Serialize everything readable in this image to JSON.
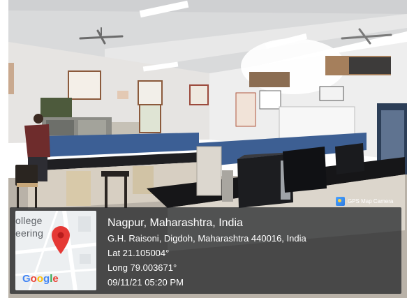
{
  "stamp": {
    "city": "Nagpur, Maharashtra, India",
    "address": "G.H. Raisoni, Digdoh, Maharashtra 440016, India",
    "lat": "Lat 21.105004°",
    "long": "Long 79.003671°",
    "datetime": "09/11/21 05:20 PM"
  },
  "map": {
    "label_line1": "ollege",
    "label_line2": "eering",
    "brand": [
      "G",
      "o",
      "o",
      "g",
      "l",
      "e"
    ],
    "brand_colors": [
      "#4285F4",
      "#EA4335",
      "#FBBC05",
      "#4285F4",
      "#34A853",
      "#EA4335"
    ],
    "pin_color": "#e53935"
  },
  "badge": {
    "label": "GPS Map Camera",
    "icon": "gps-map-camera-icon"
  }
}
